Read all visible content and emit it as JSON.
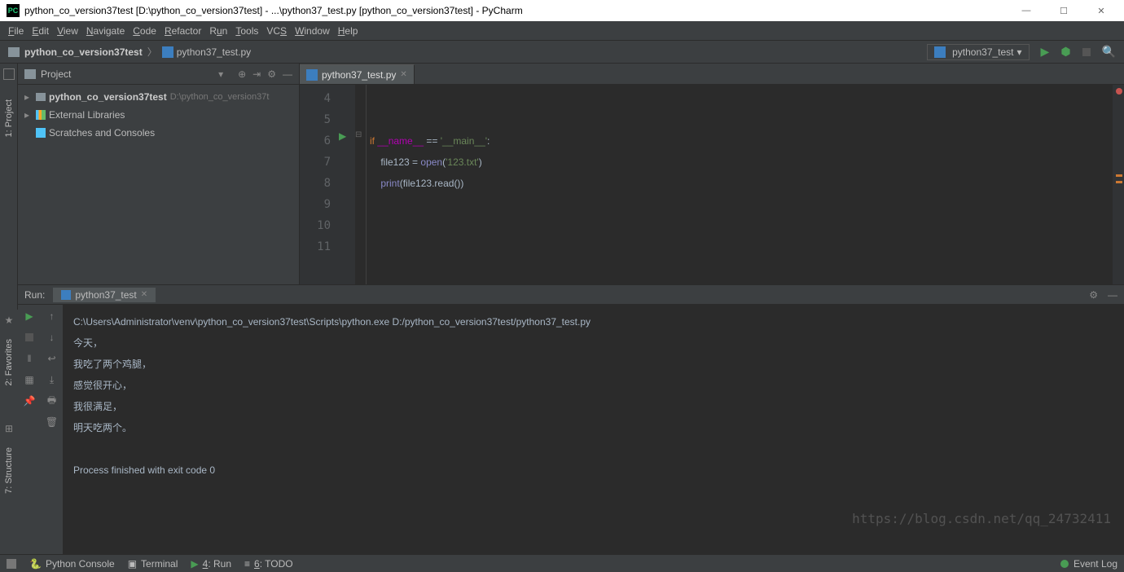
{
  "window": {
    "title": "python_co_version37test [D:\\python_co_version37test] - ...\\python37_test.py [python_co_version37test] - PyCharm"
  },
  "menu": {
    "file": "File",
    "edit": "Edit",
    "view": "View",
    "navigate": "Navigate",
    "code": "Code",
    "refactor": "Refactor",
    "run": "Run",
    "tools": "Tools",
    "vcs": "VCS",
    "window": "Window",
    "help": "Help"
  },
  "breadcrumb": {
    "root": "python_co_version37test",
    "file": "python37_test.py"
  },
  "runConfig": {
    "name": "python37_test"
  },
  "leftTabs": {
    "project": "1: Project"
  },
  "projectPanel": {
    "title": "Project",
    "items": {
      "root": "python_co_version37test",
      "rootPath": "D:\\python_co_version37t",
      "ext": "External Libraries",
      "scratch": "Scratches and Consoles"
    }
  },
  "editor": {
    "tab": "python37_test.py",
    "lines": [
      "4",
      "5",
      "6",
      "7",
      "8",
      "9",
      "10",
      "11"
    ],
    "code": {
      "l6": {
        "if": "if",
        "name": "__name__",
        "eq": " == ",
        "main": "'__main__'",
        "colon": ":"
      },
      "l7": {
        "indent": "    ",
        "var": "file123",
        "eq": " = ",
        "open": "open",
        "p1": "(",
        "str": "'123.txt'",
        "p2": ")"
      },
      "l8": {
        "indent": "    ",
        "print": "print",
        "p1": "(",
        "var": "file123",
        "dot": ".",
        "read": "read",
        "p2": "())"
      }
    }
  },
  "runPanel": {
    "label": "Run:",
    "tab": "python37_test",
    "output": {
      "cmd": "C:\\Users\\Administrator\\venv\\python_co_version37test\\Scripts\\python.exe D:/python_co_version37test/python37_test.py",
      "l1": "今天，",
      "l2": "我吃了两个鸡腿，",
      "l3": "感觉很开心，",
      "l4": "我很满足，",
      "l5": "明天吃两个。",
      "exit": "Process finished with exit code 0"
    }
  },
  "sideTabs": {
    "favorites": "2: Favorites",
    "structure": "7: Structure"
  },
  "status": {
    "console": "Python Console",
    "terminal": "Terminal",
    "run": "4: Run",
    "todo": "6: TODO",
    "eventlog": "Event Log"
  },
  "watermark": "https://blog.csdn.net/qq_24732411"
}
